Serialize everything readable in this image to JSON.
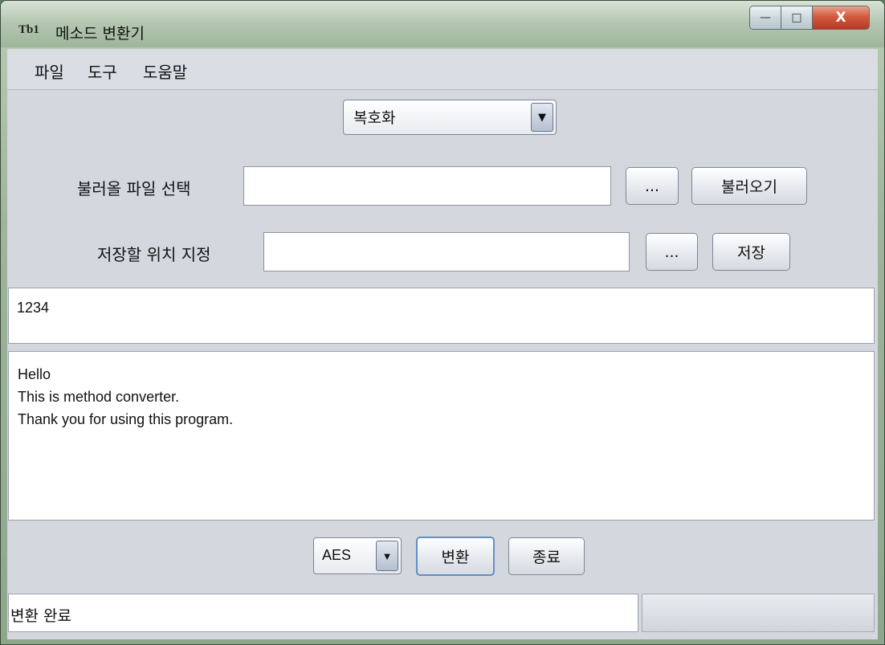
{
  "window": {
    "title": "메소드 변환기",
    "app_icon_text": "Tb1",
    "buttons": {
      "minimize": "—",
      "maximize": "□",
      "close": "X"
    }
  },
  "menu": [
    "파일",
    "도구",
    "도움말"
  ],
  "mode_select": {
    "value": "복호화",
    "arrow": "▼"
  },
  "load_row": {
    "label": "불러올 파일 선택",
    "path": "",
    "browse_label": "...",
    "action_label": "불러오기"
  },
  "save_row": {
    "label": "저장할 위치 지정",
    "path": "",
    "browse_label": "...",
    "action_label": "저장"
  },
  "password_field": {
    "value": "1234"
  },
  "message_area": {
    "lines": [
      "Hello",
      "This is method converter.",
      "Thank you for using this program."
    ]
  },
  "bottom_controls": {
    "algorithm": {
      "value": "AES",
      "arrow": "▼"
    },
    "convert_label": "변환",
    "exit_label": "종료"
  },
  "status": {
    "text": "변환 완료",
    "progress": 0
  }
}
